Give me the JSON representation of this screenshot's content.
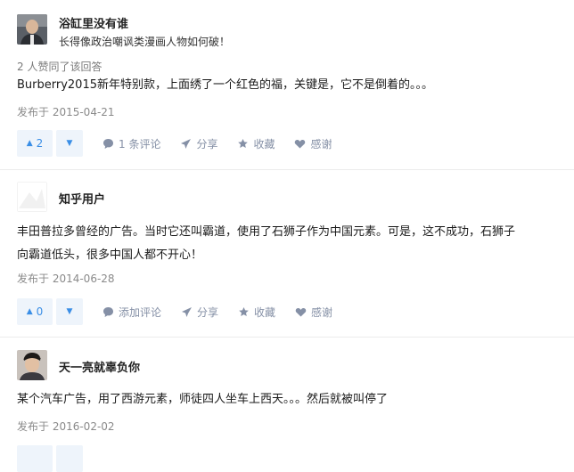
{
  "answers": [
    {
      "author": "浴缸里没有谁",
      "bio": "长得像政治嘲讽类漫画人物如何破！",
      "votes_summary": "2 人赞同了该回答",
      "content": "Burberry2015新年特别款，上面绣了一个红色的福，关键是，它不是倒着的。。。",
      "date": "发布于 2015-04-21",
      "upvotes": "2",
      "comments_label": "1 条评论",
      "share_label": "分享",
      "favorite_label": "收藏",
      "thanks_label": "感谢"
    },
    {
      "author": "知乎用户",
      "bio": "",
      "votes_summary": "",
      "content_lines": [
        "丰田普拉多曾经的广告。当时它还叫霸道，使用了石狮子作为中国元素。可是，这不成功，石狮子",
        "向霸道低头，很多中国人都不开心！"
      ],
      "date": "发布于 2014-06-28",
      "upvotes": "0",
      "comments_label": "添加评论",
      "share_label": "分享",
      "favorite_label": "收藏",
      "thanks_label": "感谢"
    },
    {
      "author": "天一亮就辜负你",
      "bio": "",
      "votes_summary": "",
      "content": "某个汽车广告，用了西游元素，师徒四人坐车上西天。。。然后就被叫停了",
      "date": "发布于 2016-02-02"
    }
  ],
  "icons": {
    "upvote": "triangle-up-icon",
    "downvote": "triangle-down-icon",
    "comment": "speech-bubble-icon",
    "share": "paper-plane-icon",
    "favorite": "star-icon",
    "thanks": "heart-icon"
  },
  "colors": {
    "vote_bg": "#eef4fb",
    "vote_fg": "#3a8ee6",
    "meta_text": "#8590a6"
  }
}
